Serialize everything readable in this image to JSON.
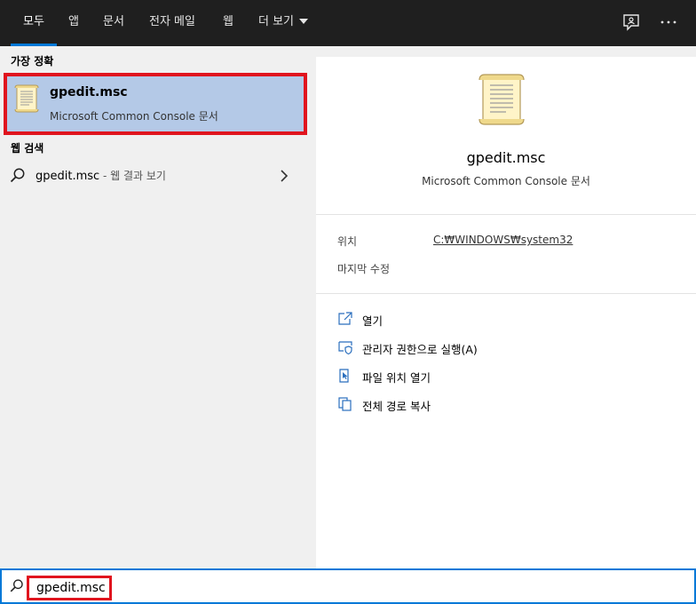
{
  "tabs": [
    {
      "label": "모두",
      "active": true
    },
    {
      "label": "앱"
    },
    {
      "label": "문서"
    },
    {
      "label": "전자 메일"
    },
    {
      "label": "웹"
    },
    {
      "label": "더 보기"
    }
  ],
  "left": {
    "best_match_header": "가장 정확",
    "best_match": {
      "title": "gpedit.msc",
      "subtitle": "Microsoft Common Console 문서"
    },
    "web_header": "웹 검색",
    "web_result": {
      "query": "gpedit.msc",
      "suffix": " - 웹 결과 보기"
    }
  },
  "right": {
    "title": "gpedit.msc",
    "subtitle": "Microsoft Common Console 문서",
    "location_label": "위치",
    "location_value": "C:₩WINDOWS₩system32",
    "modified_label": "마지막 수정",
    "actions": [
      {
        "label": "열기",
        "icon": "open-icon"
      },
      {
        "label": "관리자 권한으로 실행(A)",
        "icon": "shield-icon"
      },
      {
        "label": "파일 위치 열기",
        "icon": "file-location-icon"
      },
      {
        "label": "전체 경로 복사",
        "icon": "copy-icon"
      }
    ]
  },
  "search": {
    "value": "gpedit.msc"
  },
  "colors": {
    "accent": "#0078d7",
    "highlight": "#b4c9e7",
    "annotation_red": "#e0141e",
    "topbar": "#1f1f1f"
  }
}
